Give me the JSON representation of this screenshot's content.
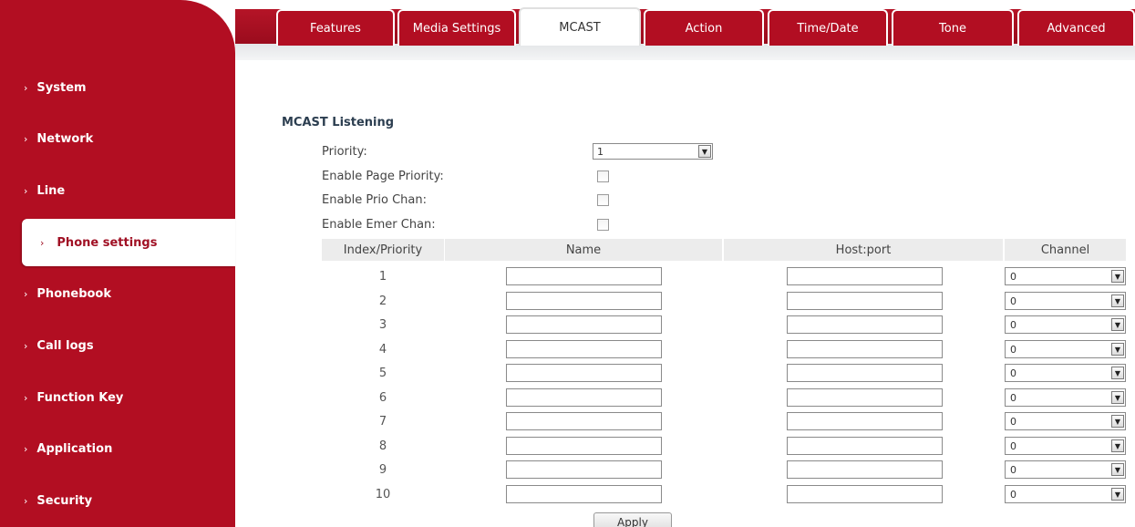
{
  "sidebar": {
    "items": [
      {
        "label": "System"
      },
      {
        "label": "Network"
      },
      {
        "label": "Line"
      },
      {
        "label": "Phone settings"
      },
      {
        "label": "Phonebook"
      },
      {
        "label": "Call logs"
      },
      {
        "label": "Function Key"
      },
      {
        "label": "Application"
      },
      {
        "label": "Security"
      }
    ],
    "active": "Phone settings",
    "chevron": "›"
  },
  "tabs": [
    {
      "label": "Features"
    },
    {
      "label": "Media Settings"
    },
    {
      "label": "MCAST"
    },
    {
      "label": "Action"
    },
    {
      "label": "Time/Date"
    },
    {
      "label": "Tone"
    },
    {
      "label": "Advanced"
    }
  ],
  "active_tab": "MCAST",
  "mcast": {
    "section_title": "MCAST Listening",
    "priority_label": "Priority:",
    "priority_value": "1",
    "page_priority_label": "Enable Page Priority:",
    "prio_chan_label": "Enable Prio Chan:",
    "emer_chan_label": "Enable Emer Chan:",
    "columns": {
      "index": "Index/Priority",
      "name": "Name",
      "host": "Host:port",
      "channel": "Channel"
    },
    "rows": [
      {
        "index": "1",
        "channel": "0"
      },
      {
        "index": "2",
        "channel": "0"
      },
      {
        "index": "3",
        "channel": "0"
      },
      {
        "index": "4",
        "channel": "0"
      },
      {
        "index": "5",
        "channel": "0"
      },
      {
        "index": "6",
        "channel": "0"
      },
      {
        "index": "7",
        "channel": "0"
      },
      {
        "index": "8",
        "channel": "0"
      },
      {
        "index": "9",
        "channel": "0"
      },
      {
        "index": "10",
        "channel": "0"
      }
    ],
    "apply_label": "Apply"
  },
  "colors": {
    "brand_red": "#b20e22",
    "header_gray": "#ececec"
  }
}
